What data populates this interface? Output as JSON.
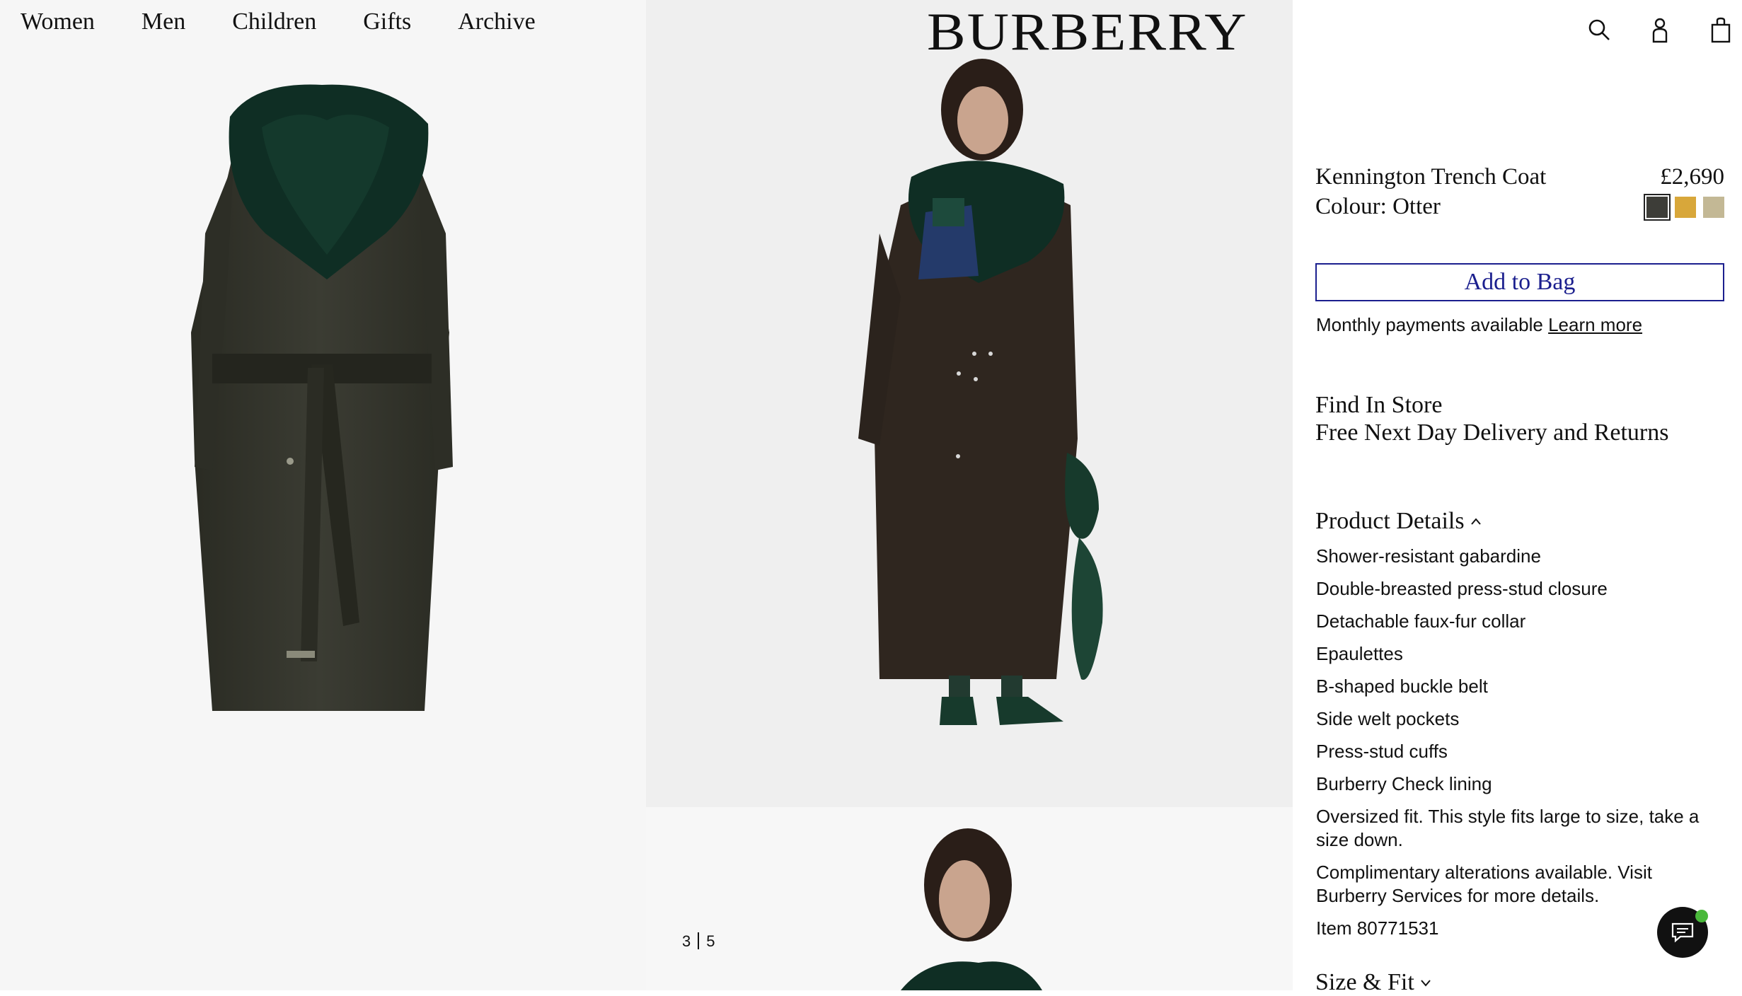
{
  "brand": "BURBERRY",
  "nav": {
    "items": [
      "Women",
      "Men",
      "Children",
      "Gifts",
      "Archive"
    ]
  },
  "header_icons": [
    "search-icon",
    "account-icon",
    "bag-icon"
  ],
  "product": {
    "name": "Kennington Trench Coat",
    "price": "£2,690",
    "colour": "Colour: Otter",
    "swatches": [
      "#3d3d38",
      "#d8a73a",
      "#c3b895"
    ]
  },
  "cta": {
    "add_to_bag": "Add to Bag"
  },
  "payments": {
    "text": "Monthly payments available",
    "link": "Learn more"
  },
  "services": {
    "find_in_store": "Find In Store",
    "delivery": "Free Next Day Delivery and Returns"
  },
  "details": {
    "title": "Product Details",
    "items": [
      "Shower-resistant gabardine",
      "Double-breasted press-stud closure",
      "Detachable faux-fur collar",
      "Epaulettes",
      "B-shaped buckle belt",
      "Side welt pockets",
      "Press-stud cuffs",
      "Burberry Check lining",
      "Oversized fit. This style fits large to size, take a size down.",
      "Complimentary alterations available. Visit Burberry Services for more details.",
      "Item 80771531"
    ]
  },
  "size_fit": {
    "title": "Size & Fit"
  },
  "gallery": {
    "current": "3",
    "total": "5"
  },
  "colors": {
    "accent": "#1b1f8e",
    "chat_bg": "#111111",
    "online": "#49b83a"
  }
}
